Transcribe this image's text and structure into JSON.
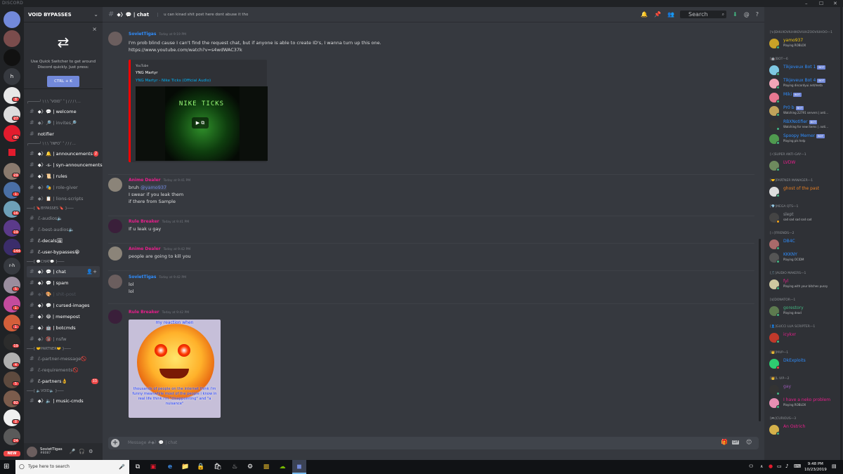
{
  "window": {
    "app_name": "DISCORD",
    "controls": [
      "–",
      "☐",
      "✕"
    ]
  },
  "guild_badges": [
    {
      "text": "8"
    },
    {
      "text": "27"
    },
    {
      "text": "5"
    },
    {
      "text": "1"
    },
    {
      "text": "29"
    },
    {
      "text": "3"
    },
    {
      "text": "19"
    },
    {
      "text": "16"
    },
    {
      "text": "1"
    },
    {
      "text": "144"
    },
    {
      "text": "5"
    },
    {
      "text": "1"
    },
    {
      "text": "1"
    },
    {
      "text": "1"
    },
    {
      "text": "19"
    },
    {
      "text": "4"
    },
    {
      "text": "5"
    },
    {
      "text": "92"
    },
    {
      "text": "8"
    },
    {
      "text": "24"
    }
  ],
  "guild_labels": {
    "h": "h",
    "rh": "r-h"
  },
  "new_badge": "NEW",
  "server": {
    "name": "VOID BYPASSES",
    "chevron": "⌄"
  },
  "quick_switcher": {
    "close": "×",
    "text": "Use Quick Switcher to get around Discord quickly. Just press:",
    "button": "CTRL + K"
  },
  "channel_list": [
    {
      "kind": "cat",
      "label": "╭─────╯ \\ \\ \\ ˚VOID˚ ˚ | / / / \\ ..."
    },
    {
      "kind": "ch",
      "label": "◆〉💬 | welcome",
      "style": "bold"
    },
    {
      "kind": "ch",
      "label": "◆〉🔎 | invites🔎",
      "style": "normal"
    },
    {
      "kind": "ch",
      "label": "notifier",
      "style": "bold"
    },
    {
      "kind": "cat",
      "label": "╭─────╯ \\ \\ \\ ˚INFO˚ ˚ / / / ..."
    },
    {
      "kind": "ch",
      "label": "◆〉🔔 | announcements",
      "style": "bold",
      "count": "2"
    },
    {
      "kind": "ch",
      "label": "◆〉-s- | syn-announcements",
      "style": "bold"
    },
    {
      "kind": "ch",
      "label": "◆〉📜 | rules",
      "style": "bold"
    },
    {
      "kind": "ch",
      "label": "◆〉🎭 | role-giver",
      "style": "normal"
    },
    {
      "kind": "ch",
      "label": "◆〉📋 | lions-scripts",
      "style": "normal"
    },
    {
      "kind": "cat",
      "label": "───{ 🔖BYPASSES 🔖 }───"
    },
    {
      "kind": "ch",
      "label": "ℰ-audios🔈",
      "style": "normal"
    },
    {
      "kind": "ch",
      "label": "ℰ-best-audios🔈",
      "style": "normal"
    },
    {
      "kind": "ch",
      "label": "ℰ-decals🖼",
      "style": "bold"
    },
    {
      "kind": "ch",
      "label": "ℰ-user-bypasses😀",
      "style": "bold"
    },
    {
      "kind": "cat",
      "label": "───{ 💬CHAT💬 }───"
    },
    {
      "kind": "ch",
      "label": "◆〉💬 | chat",
      "style": "selected"
    },
    {
      "kind": "ch",
      "label": "◆〉💬 | spam",
      "style": "bold"
    },
    {
      "kind": "ch",
      "label": "◆〉🎨 | shit-post",
      "style": "muted"
    },
    {
      "kind": "ch",
      "label": "◆〉💬 | cursed-images",
      "style": "bold"
    },
    {
      "kind": "ch",
      "label": "◆〉😂 | memepost",
      "style": "bold"
    },
    {
      "kind": "ch",
      "label": "◆〉🤖 | botcmds",
      "style": "bold"
    },
    {
      "kind": "ch",
      "label": "◆〉🔞 | nsfw",
      "style": "normal"
    },
    {
      "kind": "cat",
      "label": "───{ 🤝PARTNER🤝 }───"
    },
    {
      "kind": "ch",
      "label": "ℰ-partner-message🚫",
      "style": "normal"
    },
    {
      "kind": "ch",
      "label": "ℰ-requirements🚫",
      "style": "normal"
    },
    {
      "kind": "ch",
      "label": "ℰ-partners👌",
      "style": "bold",
      "count": "33"
    },
    {
      "kind": "cat",
      "label": "───{ 🔈VOID🔈 }───"
    },
    {
      "kind": "ch",
      "label": "◆〉🔈 | music-cmds",
      "style": "bold"
    }
  ],
  "user_panel": {
    "name": "SovietTigas",
    "tag": "#8087",
    "icons": [
      "🎤",
      "🎧",
      "⚙"
    ]
  },
  "channel_header": {
    "channel": "◆〉💬 | chat",
    "topic": "u can kinad shit post here dont abuse it tho",
    "search_placeholder": "Search",
    "icons": [
      "🔔",
      "📌",
      "👥",
      "⬇",
      "@",
      "?"
    ]
  },
  "messages": [
    {
      "author": "SovietTigas",
      "author_color": "#2f8eff",
      "time": "Today at 9:19 PM",
      "lines": [
        "I'm prob blind cause I can't find the request chat, but if anyone is able to create ID's, I wanna turn up this one.",
        "https://www.youtube.com/watch?v=s4wdWAC37k"
      ],
      "embed": {
        "provider": "YouTube",
        "author": "YNG Martyr",
        "title": "YNG Martyr - Nike Ticks (Official Audio)",
        "thumb_text": "NIKE TICKS"
      }
    },
    {
      "author": "Anime Dealer",
      "author_color": "#e91e8c",
      "time": "Today at 9:41 PM",
      "lines": [
        "bruh ",
        "I swear if you leak them",
        "if there from Sample"
      ],
      "mention": "@yamo937"
    },
    {
      "author": "Rule Breaker",
      "author_color": "#e91e8c",
      "time": "Today at 9:41 PM",
      "lines": [
        "If u leak u gay"
      ]
    },
    {
      "author": "Anime Dealer",
      "author_color": "#e91e8c",
      "time": "Today at 9:42 PM",
      "lines": [
        "people are going to kill you"
      ]
    },
    {
      "author": "SovietTigas",
      "author_color": "#2f8eff",
      "time": "Today at 9:42 PM",
      "lines": [
        "lol",
        "lol"
      ]
    },
    {
      "author": "Rule Breaker",
      "author_color": "#e91e8c",
      "time": "Today at 9:42 PM",
      "lines": [],
      "image": {
        "top_text": "my reaction when",
        "bottom_text": "thousands of people on the internet think i'm funny meanwhile most of the people i know in real life think i'm \"disappointing\" and \"a nuisance\""
      }
    }
  ],
  "composer": {
    "placeholder": "Message #◆〉💬 | chat",
    "icons": [
      "🎁",
      "GIF",
      "😊"
    ]
  },
  "member_groups": [
    {
      "label": "[↯]ÐHUXOVIUHIKOVIUHZOOVIUHOO—1",
      "members": [
        {
          "name": "yamo937",
          "color": "#f1c40f",
          "status": "Playing ROBLOX",
          "dot": "#43b581",
          "avatar": "#c9a227"
        }
      ]
    },
    {
      "label": "[🤖]BOT—6",
      "members": [
        {
          "name": "Tikjeveux Bot 1",
          "color": "#2f8eff",
          "status": "",
          "bot": "BOT",
          "dot": "#43b581",
          "avatar": "#7ec8e3"
        },
        {
          "name": "Tikjeveux Bot 4",
          "color": "#2f8eff",
          "status": "Playing discordyui.net/meta",
          "bot": "BOT",
          "dot": "#43b581",
          "avatar": "#f2a6b8"
        },
        {
          "name": "Miki",
          "color": "#2f8eff",
          "status": "",
          "bot": "BOT",
          "dot": "#43b581",
          "avatar": "#e87891"
        },
        {
          "name": "Pr0 b",
          "color": "#2f8eff",
          "status": "Watching 22791 servers | anti...",
          "bot": "BOT",
          "dot": "#43b581",
          "avatar": "#c1a35b"
        },
        {
          "name": "RBXNotifier",
          "color": "#2f8eff",
          "status": "Watching for new items | .noti...",
          "bot": "BOT",
          "dot": "#43b581",
          "avatar": "#333"
        },
        {
          "name": "Spoopy Memer",
          "color": "#2f8eff",
          "status": "Playing pls help",
          "bot": "BOT",
          "dot": "#43b581",
          "avatar": "#4f9a4f"
        }
      ]
    },
    {
      "label": "[⚡]SUPER ANTI-GAY—1",
      "members": [
        {
          "name": "LVDW",
          "color": "#e91e8c",
          "status": "",
          "dot": "#43b581",
          "avatar": "#6e8a5e"
        }
      ]
    },
    {
      "label": "[🤝]PARTNER MANAGER—1",
      "members": [
        {
          "name": "ghost of the past",
          "color": "#e67e22",
          "status": "",
          "dot": "#43b581",
          "avatar": "#ddd"
        }
      ]
    },
    {
      "label": "[💎]MEGA QTS—1",
      "members": [
        {
          "name": "slept",
          "color": "#8e9297",
          "status": "sad sad sad sad sad",
          "dot": "#faa61a",
          "avatar": "#444"
        }
      ]
    },
    {
      "label": "[☆]FRIENDS—2",
      "members": [
        {
          "name": "DB4C",
          "color": "#2f8eff",
          "status": "",
          "dot": "#43b581",
          "avatar": "#a86a6a"
        },
        {
          "name": "KKKNY",
          "color": "#2f8eff",
          "status": "Playing OCIDM",
          "dot": "#43b581",
          "avatar": "#555"
        }
      ]
    },
    {
      "label": "[🎵]AUDIO MAKERS—1",
      "members": [
        {
          "name": "fyl",
          "color": "#e91e8c",
          "status": "Playing with your bitches pussy",
          "dot": "#43b581",
          "avatar": "#cfc9a0"
        }
      ]
    },
    {
      "label": "[$]DONATOR—1",
      "members": [
        {
          "name": "gorestory",
          "color": "#43b581",
          "status": "Playing dead",
          "dot": "#43b581",
          "avatar": "#5d7a4f"
        }
      ]
    },
    {
      "label": "[👤]GUCCI LUA SCRIPTER—1",
      "members": [
        {
          "name": "icykxr",
          "color": "#e91e8c",
          "status": "",
          "dot": "#43b581",
          "avatar": "#c0392b"
        }
      ]
    },
    {
      "label": "[👑]MVP—1",
      "members": [
        {
          "name": "DkExploits",
          "color": "#2f8eff",
          "status": "",
          "dot": "#f04747",
          "avatar": "#2ecc71"
        }
      ]
    },
    {
      "label": "[👑]L VIP—2",
      "members": [
        {
          "name": "gay",
          "color": "#9b59b6",
          "status": "",
          "dot": "#43b581",
          "avatar": "#333"
        },
        {
          "name": "I have a neko problem",
          "color": "#e91e8c",
          "status": "Playing ROBLOX",
          "dot": "#43b581",
          "avatar": "#e78fb3"
        }
      ]
    },
    {
      "label": "[🎮]CURIOUS—3",
      "members": [
        {
          "name": "An Ostrich",
          "color": "#e91e8c",
          "status": "",
          "dot": "#43b581",
          "avatar": "#d4b04a"
        }
      ]
    }
  ],
  "taskbar": {
    "search_placeholder": "Type here to search",
    "time": "9:48 PM",
    "date": "10/23/2019",
    "icons": [
      "⧉",
      "▣",
      "e",
      "📁",
      "🔒",
      "🛍",
      "♨",
      "⚙",
      "▩",
      "☁",
      "◼"
    ]
  },
  "colors": {
    "accent": "#7289da",
    "link": "#00b0f4",
    "danger": "#f04747",
    "online": "#43b581"
  }
}
